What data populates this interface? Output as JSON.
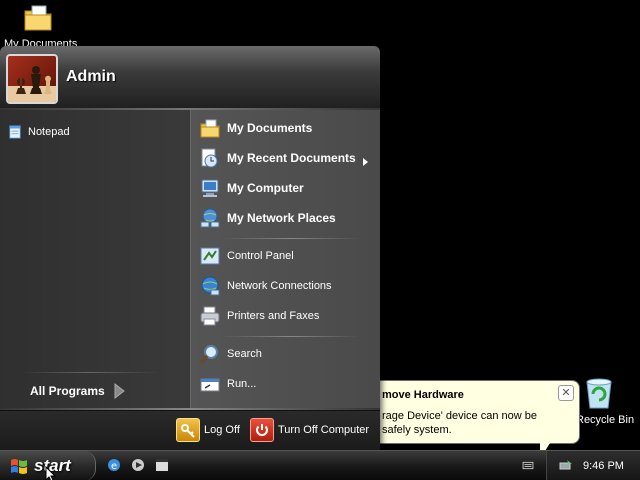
{
  "desktop": {
    "icons": [
      {
        "label": "My Documents",
        "icon": "folder-documents-icon"
      },
      {
        "label": "Recycle Bin",
        "icon": "recycle-bin-icon"
      }
    ]
  },
  "start_menu": {
    "user": {
      "name": "Admin",
      "avatar": "chess-pieces-avatar"
    },
    "pinned": [
      {
        "label": "Notepad",
        "icon": "notepad-icon"
      }
    ],
    "all_programs_label": "All Programs",
    "places": [
      {
        "label": "My Documents",
        "icon": "my-documents-icon"
      },
      {
        "label": "My Recent Documents",
        "icon": "recent-documents-icon"
      },
      {
        "label": "My Computer",
        "icon": "my-computer-icon"
      },
      {
        "label": "My Network Places",
        "icon": "network-places-icon"
      }
    ],
    "system": [
      {
        "label": "Control Panel",
        "icon": "control-panel-icon"
      },
      {
        "label": "Network Connections",
        "icon": "network-connections-icon"
      },
      {
        "label": "Printers and Faxes",
        "icon": "printer-icon"
      }
    ],
    "tools": [
      {
        "label": "Search",
        "icon": "search-icon"
      },
      {
        "label": "Run...",
        "icon": "run-icon"
      }
    ],
    "footer": {
      "logoff_label": "Log Off",
      "turnoff_label": "Turn Off Computer"
    }
  },
  "balloon": {
    "title": "move Hardware",
    "text": "rage Device' device can now be safely system."
  },
  "taskbar": {
    "start_label": "start",
    "clock": "9:46 PM"
  },
  "colors": {
    "balloon_bg": "#ffffe1",
    "logoff_accent": "#e0a21c",
    "turnoff_accent": "#d23a24"
  }
}
